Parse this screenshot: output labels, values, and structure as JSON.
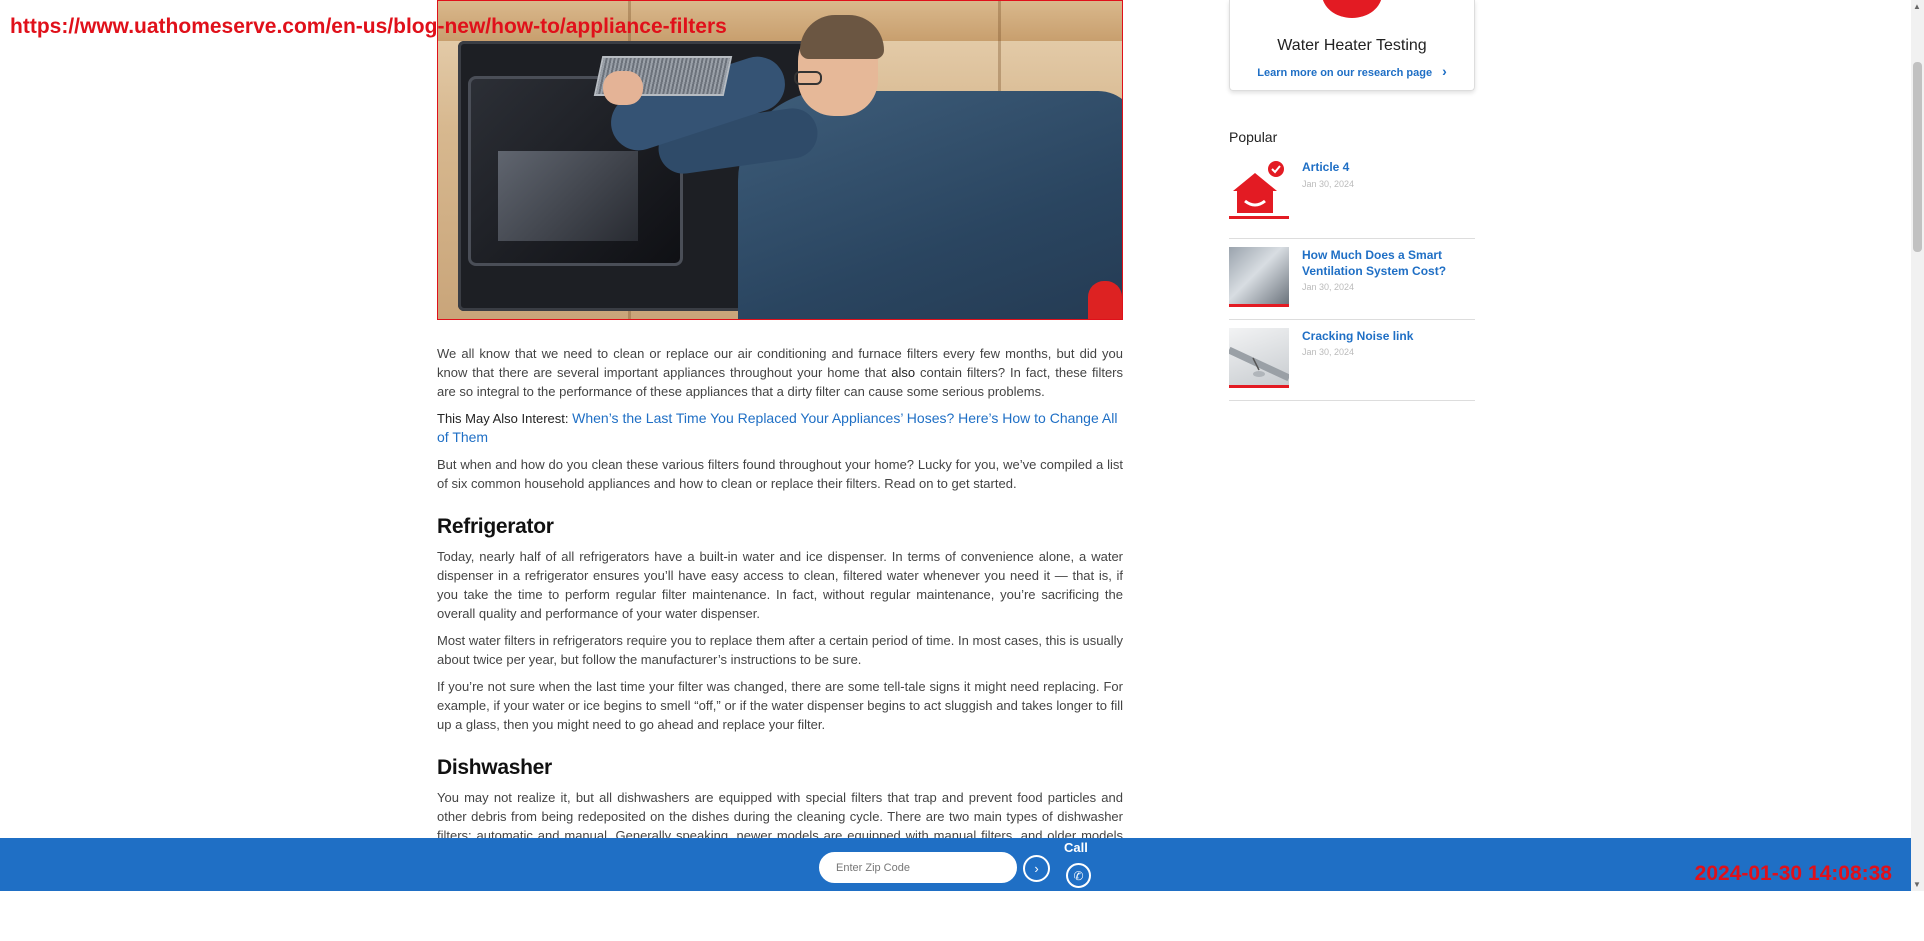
{
  "overlay": {
    "url": "https://www.uathomeserve.com/en-us/blog-new/how-to/appliance-filters",
    "timestamp": "2024-01-30 14:08:38"
  },
  "article": {
    "intro": "We all know that we need to clean or replace our air conditioning and furnace filters every few months, but did you know that there are several important appliances throughout your home that also contain filters? In fact, these filters are so integral to the performance of these appliances that a dirty filter can cause some serious problems.",
    "intro_parts": {
      "before": "We all know that we need to clean or replace our air conditioning and furnace filters every few months, but did you know that there are several important appliances throughout your home that ",
      "emph": "also",
      "after": " contain filters? In fact, these filters are so integral to the performance of these appliances that a dirty filter can cause some serious problems."
    },
    "also_prefix": "This May Also Interest:",
    "also_link": "When’s the Last Time You Replaced Your Appliances’ Hoses? Here’s How to Change All of Them",
    "lead": "But when and how do you clean these various filters found throughout your home? Lucky for you, we’ve compiled a list of six common household appliances and how to clean or replace their filters. Read on to get started.",
    "sections": [
      {
        "heading": "Refrigerator",
        "paragraphs": [
          "Today, nearly half of all refrigerators have a built-in water and ice dispenser. In terms of convenience alone, a water dispenser in a refrigerator ensures you’ll have easy access to clean, filtered water whenever you need it — that is, if you take the time to perform regular filter maintenance. In fact, without regular maintenance, you’re sacrificing the overall quality and performance of your water dispenser.",
          "Most water filters in refrigerators require you to replace them after a certain period of time. In most cases, this is usually about twice per year, but follow the manufacturer’s instructions to be sure.",
          "If you’re not sure when the last time your filter was changed, there are some tell-tale signs it might need replacing. For example, if your water or ice begins to smell “off,” or if the water dispenser begins to act sluggish and takes longer to fill up a glass, then you might need to go ahead and replace your filter."
        ]
      },
      {
        "heading": "Dishwasher",
        "paragraphs": [
          "You may not realize it, but all dishwashers are equipped with special filters that trap and prevent food particles and other debris from being redeposited on the dishes during the cleaning cycle. There are two main types of dishwasher filters: automatic and manual. Generally speaking, newer models are equipped with manual filters, and older models use"
        ]
      }
    ]
  },
  "sidebar": {
    "card": {
      "title": "Water Heater Testing",
      "link": "Learn more on our research page"
    },
    "popular_heading": "Popular",
    "popular": [
      {
        "title": "Article 4",
        "date": "Jan 30, 2024",
        "icon": "house-check-icon"
      },
      {
        "title": "How Much Does a Smart Ventilation System Cost?",
        "date": "Jan 30, 2024",
        "icon": "car-snow-photo"
      },
      {
        "title": "Cracking Noise link",
        "date": "Jan 30, 2024",
        "icon": "pipe-photo"
      }
    ]
  },
  "bottom_bar": {
    "zip_placeholder": "Enter Zip Code",
    "zip_value": "",
    "call_label": "Call",
    "brand_color": "#1f6fc5",
    "accent_color": "#e31b23"
  }
}
